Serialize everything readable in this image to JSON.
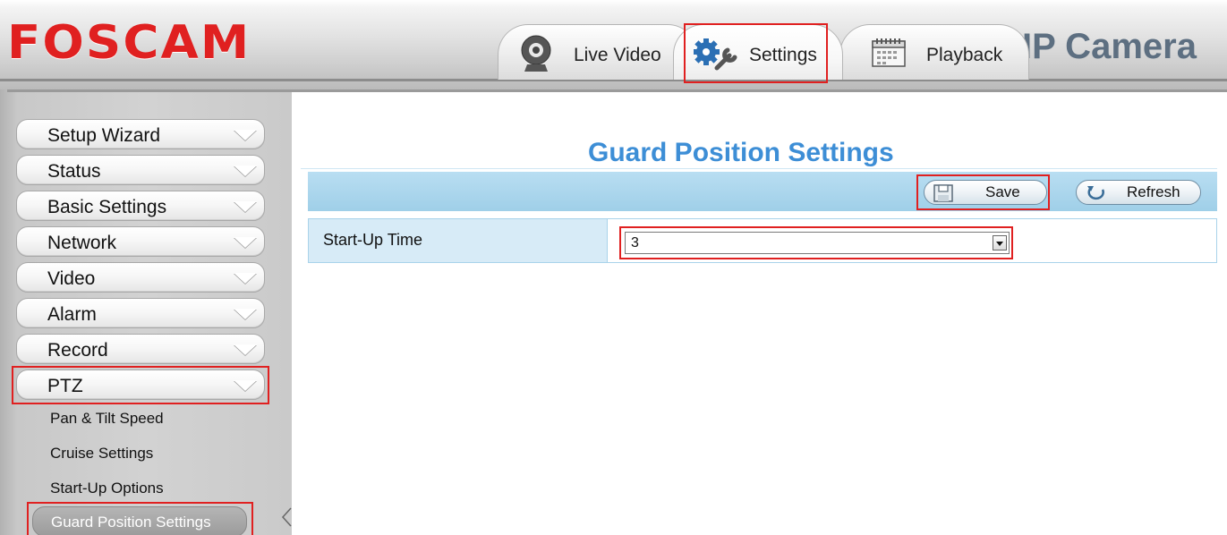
{
  "header": {
    "logo_text": "FOSCAM",
    "brand_title": "IP Camera",
    "tabs": [
      {
        "label": "Live Video",
        "icon": "webcam-icon"
      },
      {
        "label": "Settings",
        "icon": "gear-wrench-icon"
      },
      {
        "label": "Playback",
        "icon": "calendar-icon"
      }
    ]
  },
  "sidebar": {
    "items": [
      {
        "label": "Setup Wizard"
      },
      {
        "label": "Status"
      },
      {
        "label": "Basic Settings"
      },
      {
        "label": "Network"
      },
      {
        "label": "Video"
      },
      {
        "label": "Alarm"
      },
      {
        "label": "Record"
      },
      {
        "label": "PTZ"
      }
    ],
    "sub_items": [
      {
        "label": "Pan & Tilt Speed"
      },
      {
        "label": "Cruise Settings"
      },
      {
        "label": "Start-Up Options"
      },
      {
        "label": "Guard Position Settings"
      }
    ]
  },
  "main": {
    "title": "Guard Position Settings",
    "toolbar": {
      "save_label": "Save",
      "refresh_label": "Refresh"
    },
    "form": {
      "startup_time_label": "Start-Up Time",
      "startup_time_value": "3"
    }
  },
  "colors": {
    "highlight": "#e02020",
    "logo": "#e02020",
    "title": "#3d8ed6",
    "toolbar": "#a8d4ec"
  }
}
